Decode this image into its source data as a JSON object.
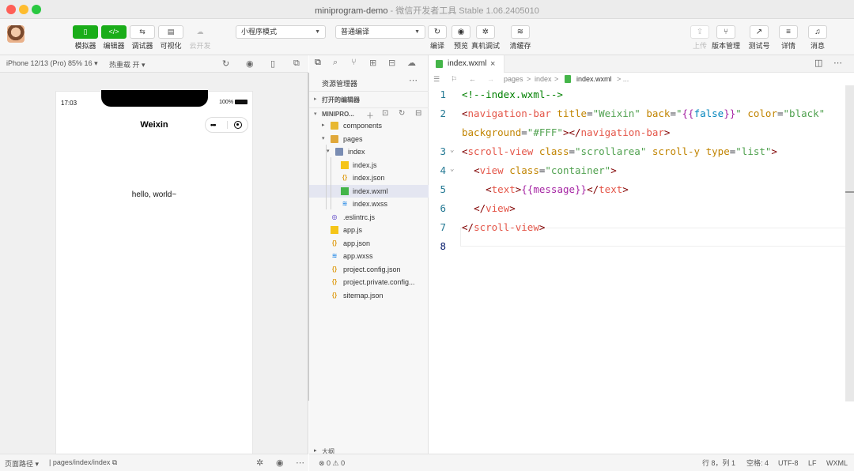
{
  "window": {
    "title": "miniprogram-demo",
    "subtitle": " - 微信开发者工具 Stable 1.06.2405010"
  },
  "toolbar": {
    "left_buttons": [
      {
        "label": "模拟器",
        "icon": "phone-icon",
        "glyph": "▯",
        "active": true
      },
      {
        "label": "编辑器",
        "icon": "code-icon",
        "glyph": "</>",
        "active": true
      },
      {
        "label": "调试器",
        "icon": "debug-icon",
        "glyph": "⇆",
        "active": false
      },
      {
        "label": "可视化",
        "icon": "layout-icon",
        "glyph": "▤",
        "active": false
      },
      {
        "label": "云开发",
        "icon": "cloud-icon",
        "glyph": "☁",
        "active": false,
        "disabled": true
      }
    ],
    "mode_select": "小程序模式",
    "compile_select": "普通编译",
    "mid_buttons": [
      {
        "label": "编译",
        "icon": "refresh-icon",
        "glyph": "↻"
      },
      {
        "label": "预览",
        "icon": "eye-icon",
        "glyph": "◉"
      },
      {
        "label": "真机调试",
        "icon": "bug-icon",
        "glyph": "✲"
      },
      {
        "label": "清缓存",
        "icon": "layers-icon",
        "glyph": "≋"
      }
    ],
    "right_buttons": [
      {
        "label": "上传",
        "icon": "upload-icon",
        "glyph": "⇪",
        "disabled": true
      },
      {
        "label": "版本管理",
        "icon": "branch-icon",
        "glyph": "⑂"
      },
      {
        "label": "测试号",
        "icon": "external-icon",
        "glyph": "↗"
      },
      {
        "label": "详情",
        "icon": "menu-icon",
        "glyph": "≡"
      },
      {
        "label": "消息",
        "icon": "bell-icon",
        "glyph": "♫"
      }
    ]
  },
  "simulator": {
    "device": "iPhone 12/13 (Pro) 85% 16 ▾",
    "hot_reload": "热重载 开 ▾",
    "phone": {
      "time": "17:03",
      "battery": "100%",
      "nav_title": "Weixin",
      "capsule_dots": "•••",
      "content": "hello, world~"
    },
    "status_path_label": "页面路径 ▾",
    "status_path": "pages/index/index"
  },
  "explorer": {
    "title": "资源管理器",
    "more": "⋯",
    "open_editors": "打开的编辑器",
    "project": "MINIPRO...",
    "outline": "大纲",
    "tree": [
      {
        "name": "components",
        "type": "folder",
        "depth": 1,
        "arrow": "▸"
      },
      {
        "name": "pages",
        "type": "folder-open",
        "depth": 1,
        "arrow": "▾"
      },
      {
        "name": "index",
        "type": "folder-blue",
        "depth": 2,
        "arrow": "▾"
      },
      {
        "name": "index.js",
        "type": "js",
        "depth": 3
      },
      {
        "name": "index.json",
        "type": "json",
        "depth": 3
      },
      {
        "name": "index.wxml",
        "type": "wxml",
        "depth": 3,
        "selected": true
      },
      {
        "name": "index.wxss",
        "type": "wxss",
        "depth": 3
      },
      {
        "name": ".eslintrc.js",
        "type": "eslint",
        "depth": 1
      },
      {
        "name": "app.js",
        "type": "js",
        "depth": 1
      },
      {
        "name": "app.json",
        "type": "json",
        "depth": 1
      },
      {
        "name": "app.wxss",
        "type": "wxss",
        "depth": 1
      },
      {
        "name": "project.config.json",
        "type": "json",
        "depth": 1
      },
      {
        "name": "project.private.config...",
        "type": "json",
        "depth": 1
      },
      {
        "name": "sitemap.json",
        "type": "json",
        "depth": 1
      }
    ]
  },
  "editor": {
    "tab_name": "index.wxml",
    "tab_close": "×",
    "breadcrumbs": [
      "pages",
      ">",
      "index",
      ">",
      "index.wxml",
      "> ..."
    ],
    "lines": [
      {
        "n": "1",
        "fold": "",
        "tokens": [
          [
            "c-comment",
            "<!--index.wxml-->"
          ]
        ]
      },
      {
        "n": "2",
        "fold": "",
        "tokens": [
          [
            "c-tag",
            "<"
          ],
          [
            "c-tagname",
            "navigation-bar"
          ],
          [
            "c-plain",
            " "
          ],
          [
            "c-attr",
            "title"
          ],
          [
            "c-plain",
            "="
          ],
          [
            "c-str",
            "\"Weixin\""
          ],
          [
            "c-plain",
            " "
          ],
          [
            "c-attr",
            "back"
          ],
          [
            "c-plain",
            "="
          ],
          [
            "c-str",
            "\""
          ],
          [
            "c-brace",
            "{{"
          ],
          [
            "c-kw",
            "false"
          ],
          [
            "c-brace",
            "}}"
          ],
          [
            "c-str",
            "\""
          ],
          [
            "c-plain",
            " "
          ],
          [
            "c-attr",
            "color"
          ],
          [
            "c-plain",
            "="
          ],
          [
            "c-str",
            "\"black\""
          ]
        ]
      },
      {
        "n": "",
        "fold": "",
        "tokens": [
          [
            "c-attr",
            "background"
          ],
          [
            "c-plain",
            "="
          ],
          [
            "c-str",
            "\"#FFF\""
          ],
          [
            "c-tag",
            "></"
          ],
          [
            "c-tagname",
            "navigation-bar"
          ],
          [
            "c-tag",
            ">"
          ]
        ]
      },
      {
        "n": "3",
        "fold": "⌄",
        "tokens": [
          [
            "c-tag",
            "<"
          ],
          [
            "c-tagname",
            "scroll-view"
          ],
          [
            "c-plain",
            " "
          ],
          [
            "c-attr",
            "class"
          ],
          [
            "c-plain",
            "="
          ],
          [
            "c-str",
            "\"scrollarea\""
          ],
          [
            "c-plain",
            " "
          ],
          [
            "c-attr",
            "scroll-y"
          ],
          [
            "c-plain",
            " "
          ],
          [
            "c-attr",
            "type"
          ],
          [
            "c-plain",
            "="
          ],
          [
            "c-str",
            "\"list\""
          ],
          [
            "c-tag",
            ">"
          ]
        ]
      },
      {
        "n": "4",
        "fold": "⌄",
        "tokens": [
          [
            "c-plain",
            "  "
          ],
          [
            "c-tag",
            "<"
          ],
          [
            "c-tagname",
            "view"
          ],
          [
            "c-plain",
            " "
          ],
          [
            "c-attr",
            "class"
          ],
          [
            "c-plain",
            "="
          ],
          [
            "c-str",
            "\"container\""
          ],
          [
            "c-tag",
            ">"
          ]
        ]
      },
      {
        "n": "5",
        "fold": "",
        "tokens": [
          [
            "c-plain",
            "    "
          ],
          [
            "c-tag",
            "<"
          ],
          [
            "c-tagname",
            "text"
          ],
          [
            "c-tag",
            ">"
          ],
          [
            "c-brace",
            "{{"
          ],
          [
            "c-brace",
            "message"
          ],
          [
            "c-brace",
            "}}"
          ],
          [
            "c-tag",
            "</"
          ],
          [
            "c-tagname",
            "text"
          ],
          [
            "c-tag",
            ">"
          ]
        ]
      },
      {
        "n": "6",
        "fold": "",
        "tokens": [
          [
            "c-plain",
            "  "
          ],
          [
            "c-tag",
            "</"
          ],
          [
            "c-tagname",
            "view"
          ],
          [
            "c-tag",
            ">"
          ]
        ]
      },
      {
        "n": "7",
        "fold": "",
        "tokens": [
          [
            "c-tag",
            "</"
          ],
          [
            "c-tagname",
            "scroll-view"
          ],
          [
            "c-tag",
            ">"
          ]
        ]
      },
      {
        "n": "8",
        "fold": "",
        "tokens": []
      }
    ]
  },
  "statusbar": {
    "problems": "⊗ 0 ⚠ 0",
    "position": "行 8，列 1",
    "indent": "空格: 4",
    "encoding": "UTF-8",
    "eol": "LF",
    "language": "WXML"
  }
}
